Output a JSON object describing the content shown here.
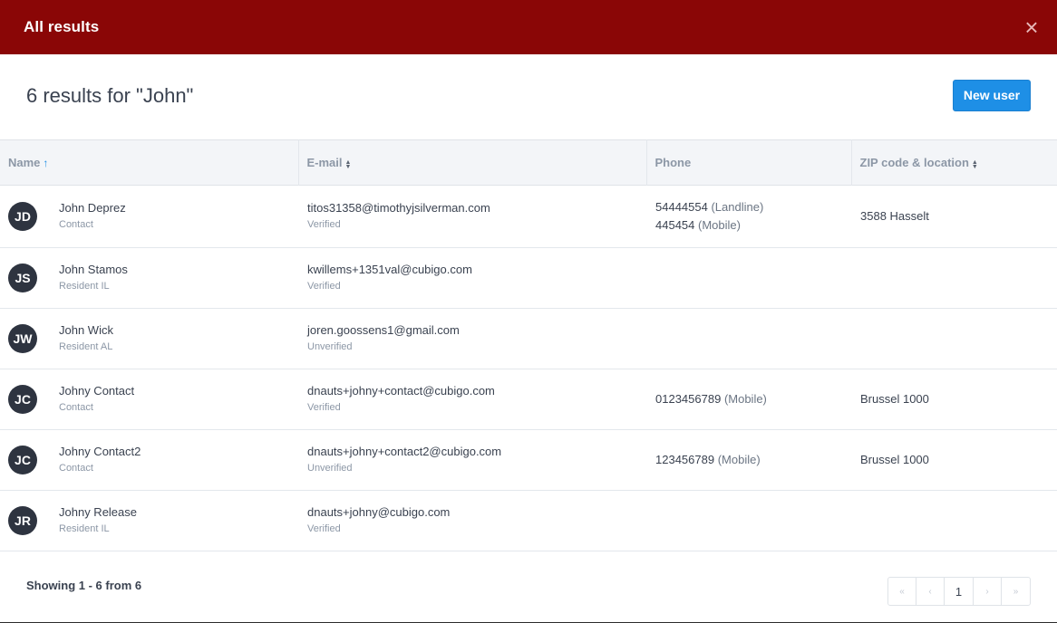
{
  "header": {
    "title": "All results",
    "close_glyph": "×"
  },
  "topbar": {
    "results_title": "6 results for \"John\"",
    "new_user_label": "New user"
  },
  "table": {
    "columns": [
      {
        "label": "Name",
        "sort": "asc"
      },
      {
        "label": "E-mail",
        "sort": "both"
      },
      {
        "label": "Phone",
        "sort": "none"
      },
      {
        "label": "ZIP code & location",
        "sort": "both"
      }
    ],
    "rows": [
      {
        "initials": "JD",
        "name": "John Deprez",
        "role": "Contact",
        "email": "titos31358@timothyjsilverman.com",
        "email_status": "Verified",
        "phones": [
          {
            "number": "54444554",
            "type": "(Landline)"
          },
          {
            "number": "445454",
            "type": "(Mobile)"
          }
        ],
        "location": "3588 Hasselt"
      },
      {
        "initials": "JS",
        "name": "John Stamos",
        "role": "Resident IL",
        "email": "kwillems+1351val@cubigo.com",
        "email_status": "Verified",
        "phones": [],
        "location": ""
      },
      {
        "initials": "JW",
        "name": "John Wick",
        "role": "Resident AL",
        "email": "joren.goossens1@gmail.com",
        "email_status": "Unverified",
        "phones": [],
        "location": ""
      },
      {
        "initials": "JC",
        "name": "Johny Contact",
        "role": "Contact",
        "email": "dnauts+johny+contact@cubigo.com",
        "email_status": "Verified",
        "phones": [
          {
            "number": "0123456789",
            "type": "(Mobile)"
          }
        ],
        "location": "Brussel 1000"
      },
      {
        "initials": "JC",
        "name": "Johny Contact2",
        "role": "Contact",
        "email": "dnauts+johny+contact2@cubigo.com",
        "email_status": "Unverified",
        "phones": [
          {
            "number": "123456789",
            "type": "(Mobile)"
          }
        ],
        "location": "Brussel 1000"
      },
      {
        "initials": "JR",
        "name": "Johny Release",
        "role": "Resident IL",
        "email": "dnauts+johny@cubigo.com",
        "email_status": "Verified",
        "phones": [],
        "location": ""
      }
    ]
  },
  "footer": {
    "showing": "Showing 1 - 6 from 6",
    "pagination": {
      "first_icon": "double-chevron-left-icon",
      "prev_icon": "chevron-left-icon",
      "current_page": "1",
      "next_icon": "chevron-right-icon",
      "last_icon": "double-chevron-right-icon"
    }
  },
  "colors": {
    "header_bg": "#8a0606",
    "accent": "#1e8fe6",
    "avatar_bg": "#2e3440"
  }
}
